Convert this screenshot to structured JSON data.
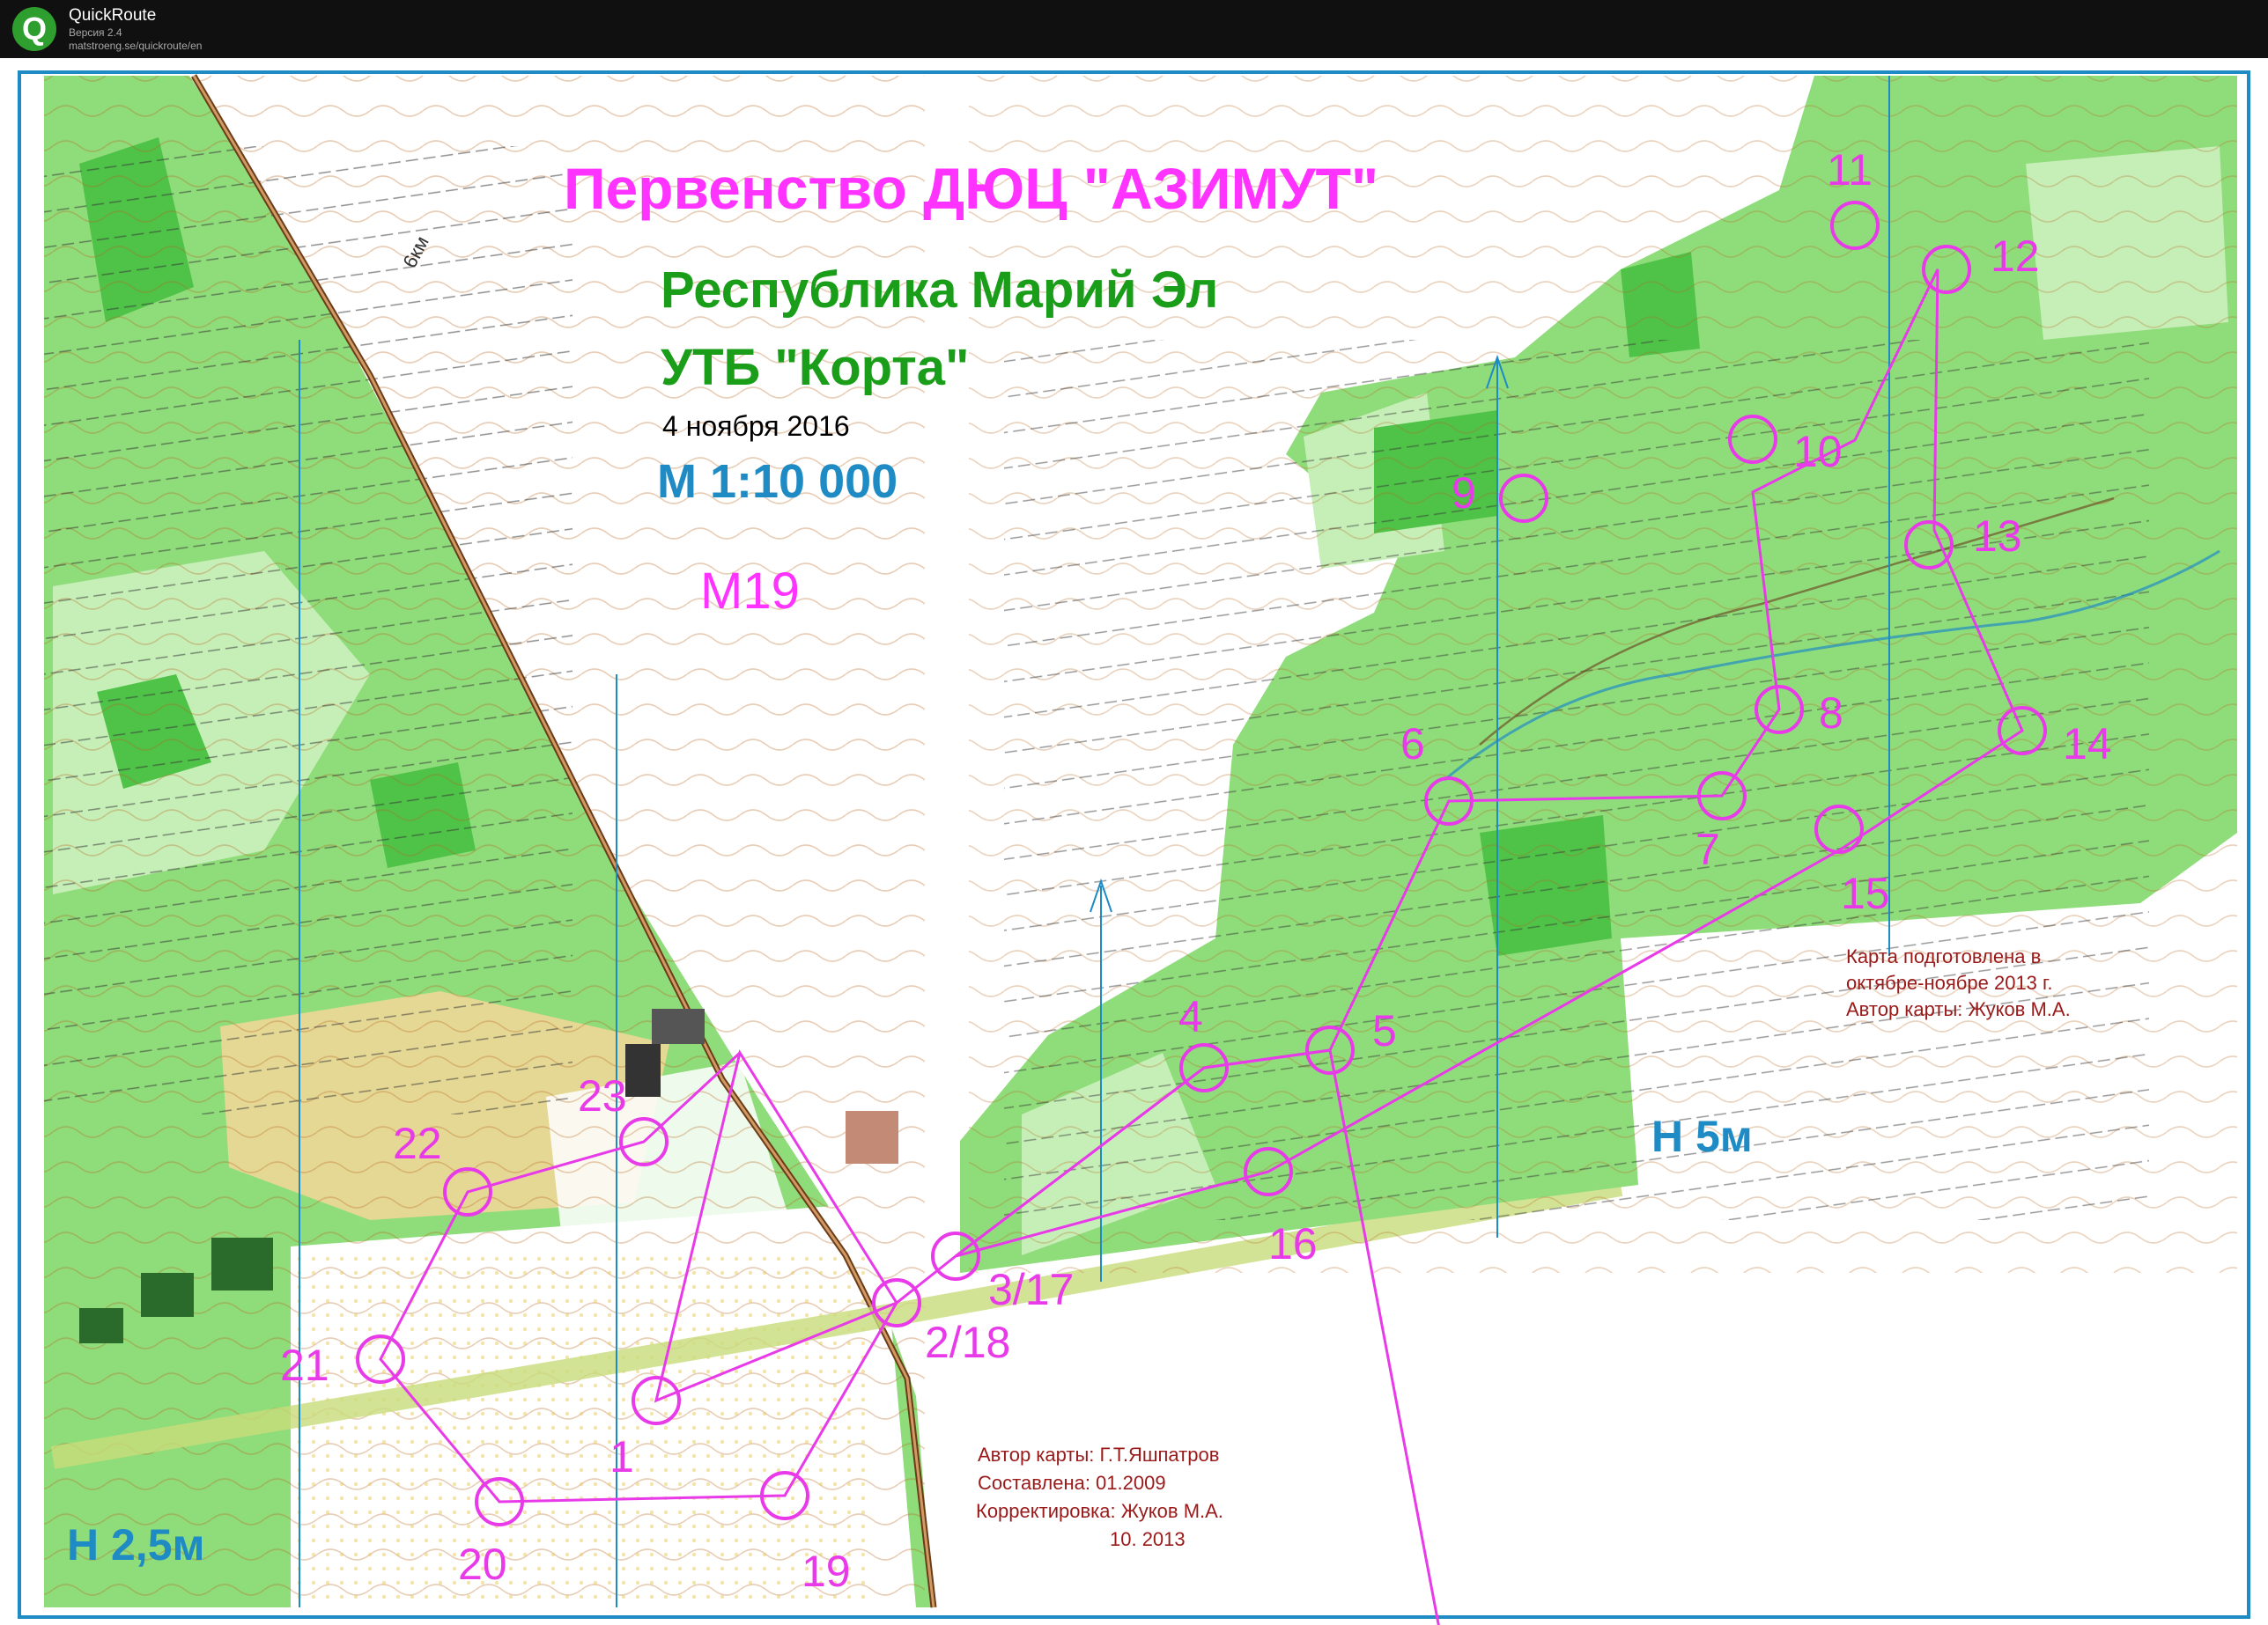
{
  "app": {
    "name": "QuickRoute",
    "version": "Версия 2.4",
    "url": "matstroeng.se/quickroute/en",
    "logo_letter": "Q"
  },
  "map": {
    "title": "Первенство ДЮЦ \"АЗИМУТ\"",
    "region": "Республика Марий Эл",
    "site": "УТБ \"Корта\"",
    "date": "4 ноября 2016",
    "scale": "М 1:10 000",
    "class": "М19",
    "contour_left": "Н 2,5м",
    "contour_right": "Н 5м",
    "road_marker": "6км",
    "credits_left": [
      "Автор карты: Г.Т.Яшпатров",
      "Составлена: 01.2009",
      "Корректировка: Жуков М.А.",
      "10. 2013"
    ],
    "credits_right": [
      "Карта подготовлена в",
      "октябре-ноябре 2013 г.",
      "Автор карты: Жуков М.А."
    ]
  },
  "colors": {
    "course": "#e83ae8",
    "forest": "#8fdc7a",
    "light_forest": "#c6efb8",
    "dark_forest": "#4fc248",
    "contour": "#b5651d",
    "water": "#1f8bc4",
    "title": "#ff33ff",
    "region": "#1a9e1a",
    "credit": "#9a1a1a",
    "open_land": "#f5d79a"
  },
  "course": {
    "start_label": "2/18",
    "controls": [
      {
        "label": "1"
      },
      {
        "label": "2/18"
      },
      {
        "label": "3/17"
      },
      {
        "label": "4"
      },
      {
        "label": "5"
      },
      {
        "label": "6"
      },
      {
        "label": "7"
      },
      {
        "label": "8"
      },
      {
        "label": "9"
      },
      {
        "label": "10"
      },
      {
        "label": "11"
      },
      {
        "label": "12"
      },
      {
        "label": "13"
      },
      {
        "label": "14"
      },
      {
        "label": "15"
      },
      {
        "label": "16"
      },
      {
        "label": "3/17"
      },
      {
        "label": "2/18"
      },
      {
        "label": "19"
      },
      {
        "label": "20"
      },
      {
        "label": "21"
      },
      {
        "label": "22"
      },
      {
        "label": "23"
      }
    ]
  }
}
